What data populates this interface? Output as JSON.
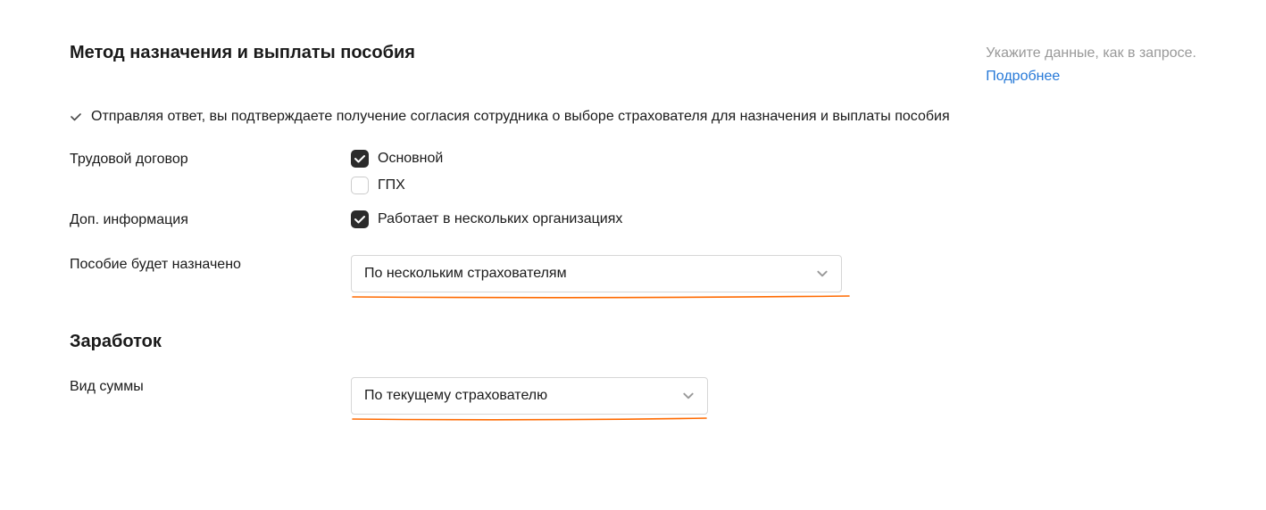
{
  "section1": {
    "title": "Метод назначения и выплаты пособия",
    "hint_text": "Укажите данные, как в запросе.",
    "hint_link": "Подробнее",
    "consent_text": "Отправляя ответ, вы подтверждаете получение согласия сотрудника о выборе страхователя для назначения и выплаты пособия"
  },
  "contract": {
    "label": "Трудовой договор",
    "opt_main": "Основной",
    "opt_gpx": "ГПХ"
  },
  "addinfo": {
    "label": "Доп. информация",
    "opt_multi": "Работает в нескольких организациях"
  },
  "benefit": {
    "label": "Пособие будет назначено",
    "value": "По нескольким страхователям"
  },
  "section2": {
    "title": "Заработок"
  },
  "amount": {
    "label": "Вид суммы",
    "value": "По текущему страхователю"
  }
}
